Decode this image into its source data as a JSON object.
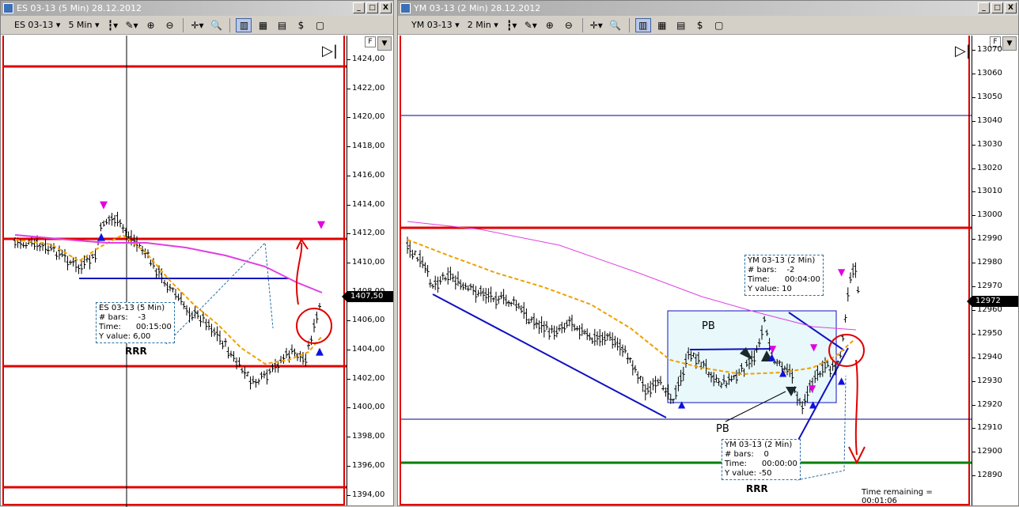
{
  "left": {
    "title": "ES 03-13 (5 Min)  28.12.2012",
    "instrument": "ES 03-13",
    "interval": "5 Min",
    "axis_ticks": [
      "1424,00",
      "1422,00",
      "1420,00",
      "1418,00",
      "1416,00",
      "1414,00",
      "1412,00",
      "1410,00",
      "1408,00",
      "1406,00",
      "1404,00",
      "1402,00",
      "1400,00",
      "1398,00",
      "1396,00",
      "1394,00"
    ],
    "last_price": "1407,50",
    "info_box": {
      "line1": "ES 03-13 (5 Min)",
      "line2": "# bars:    -3",
      "line3": "Time:      00:15:00",
      "line4": "Y value: 6,00"
    },
    "label_rrr": "RRR"
  },
  "right": {
    "title": "YM 03-13 (2 Min)  28.12.2012",
    "instrument": "YM 03-13",
    "interval": "2 Min",
    "axis_ticks": [
      "13070",
      "13060",
      "13050",
      "13040",
      "13030",
      "13020",
      "13010",
      "13000",
      "12990",
      "12980",
      "12970",
      "12960",
      "12950",
      "12940",
      "12930",
      "12920",
      "12910",
      "12900",
      "12890"
    ],
    "last_price": "12972",
    "info_box_top": {
      "line1": "YM 03-13 (2 Min)",
      "line2": "# bars:    -2",
      "line3": "Time:      00:04:00",
      "line4": "Y value: 10"
    },
    "info_box_bottom": {
      "line1": "YM 03-13 (2 Min)",
      "line2": "# bars:    0",
      "line3": "Time:      00:00:00",
      "line4": "Y value: -50"
    },
    "label_pb1": "PB",
    "label_pb2": "PB",
    "label_rrr": "RRR",
    "time_remaining": "Time remaining = 00:01:06"
  },
  "window_buttons": {
    "minimize": "_",
    "restore": "□",
    "close": "X"
  },
  "axis_f": "F",
  "colors": {
    "level_red": "#e00000",
    "trend_blue": "#1010c0",
    "ema_orange": "#f0a000",
    "ma_magenta": "#e040e0",
    "target_green": "#008000",
    "box_fill": "#e8f8fb"
  }
}
